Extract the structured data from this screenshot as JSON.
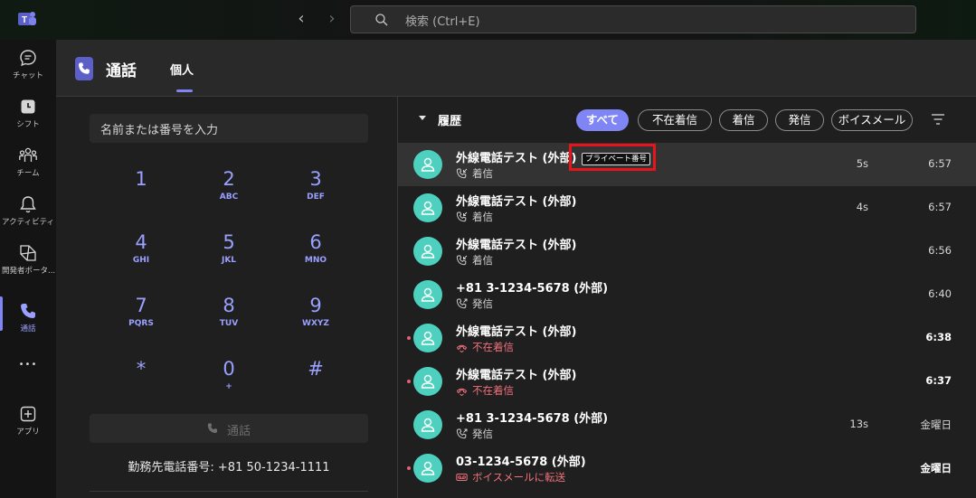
{
  "titlebar": {
    "search_placeholder": "検索 (Ctrl+E)",
    "back_glyph": "‹",
    "forward_glyph": "›"
  },
  "rail": {
    "items": [
      {
        "label": "チャット",
        "icon": "chat-icon"
      },
      {
        "label": "シフト",
        "icon": "shifts-icon"
      },
      {
        "label": "チーム",
        "icon": "teams-icon"
      },
      {
        "label": "アクティビティ",
        "icon": "bell-icon"
      },
      {
        "label": "開発者ポータ...",
        "icon": "developer-portal-icon"
      },
      {
        "label": "通話",
        "icon": "phone-icon"
      },
      {
        "label": "",
        "icon": "more-icon"
      },
      {
        "label": "アプリ",
        "icon": "apps-icon"
      }
    ],
    "more_glyph": "•••"
  },
  "header": {
    "title": "通話",
    "tab": "個人"
  },
  "dialer": {
    "placeholder": "名前または番号を入力",
    "keys": [
      {
        "digit": "1",
        "letters": ""
      },
      {
        "digit": "2",
        "letters": "ABC"
      },
      {
        "digit": "3",
        "letters": "DEF"
      },
      {
        "digit": "4",
        "letters": "GHI"
      },
      {
        "digit": "5",
        "letters": "JKL"
      },
      {
        "digit": "6",
        "letters": "MNO"
      },
      {
        "digit": "7",
        "letters": "PQRS"
      },
      {
        "digit": "8",
        "letters": "TUV"
      },
      {
        "digit": "9",
        "letters": "WXYZ"
      },
      {
        "digit": "*",
        "letters": ""
      },
      {
        "digit": "0",
        "letters": "+"
      },
      {
        "digit": "#",
        "letters": ""
      }
    ],
    "call_label": "通話",
    "work_number": "勤務先電話番号: +81 50-1234-1111"
  },
  "history": {
    "title": "履歴",
    "filters": [
      "すべて",
      "不在着信",
      "着信",
      "発信",
      "ボイスメール"
    ],
    "active_filter": "すべて",
    "private_badge": "プライベート番号",
    "rows": [
      {
        "name": "外線電話テスト (外部)",
        "type": "着信",
        "duration": "5s",
        "time": "6:57",
        "status": "incoming",
        "unread": false
      },
      {
        "name": "外線電話テスト (外部)",
        "type": "着信",
        "duration": "4s",
        "time": "6:57",
        "status": "incoming",
        "unread": false
      },
      {
        "name": "外線電話テスト (外部)",
        "type": "着信",
        "duration": "",
        "time": "6:56",
        "status": "incoming",
        "unread": false
      },
      {
        "name": "+81 3-1234-5678 (外部)",
        "type": "発信",
        "duration": "",
        "time": "6:40",
        "status": "outgoing",
        "unread": false
      },
      {
        "name": "外線電話テスト (外部)",
        "type": "不在着信",
        "duration": "",
        "time": "6:38",
        "status": "missed",
        "unread": true
      },
      {
        "name": "外線電話テスト (外部)",
        "type": "不在着信",
        "duration": "",
        "time": "6:37",
        "status": "missed",
        "unread": true
      },
      {
        "name": "+81 3-1234-5678 (外部)",
        "type": "発信",
        "duration": "13s",
        "time": "金曜日",
        "status": "outgoing",
        "unread": false
      },
      {
        "name": "03-1234-5678 (外部)",
        "type": "ボイスメールに転送",
        "duration": "",
        "time": "金曜日",
        "status": "voicemail",
        "unread": true
      }
    ]
  },
  "colors": {
    "accent": "#7f85f5",
    "missed": "#f1707b",
    "avatar": "#4dd0bd",
    "highlight_box": "#e8141b"
  }
}
